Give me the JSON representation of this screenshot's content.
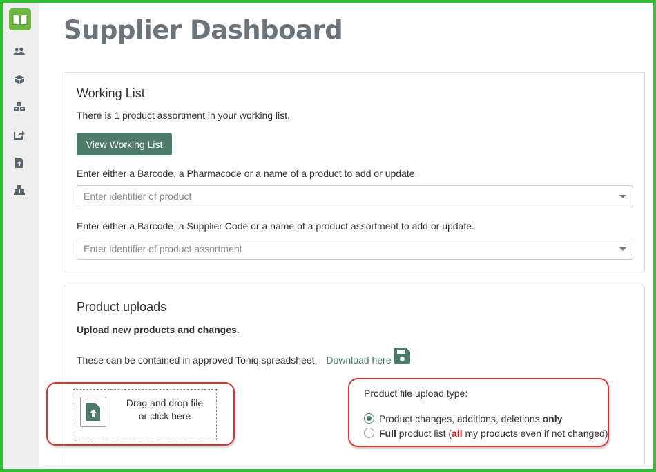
{
  "header": {
    "title": "Supplier Dashboard"
  },
  "sidebar": {
    "items": [
      {
        "icon": "users-icon"
      },
      {
        "icon": "box-icon"
      },
      {
        "icon": "boxes-icon"
      },
      {
        "icon": "share-icon"
      },
      {
        "icon": "file-upload-icon"
      },
      {
        "icon": "pallet-icon"
      }
    ]
  },
  "working_list": {
    "heading": "Working List",
    "status": "There is 1 product assortment in your working list.",
    "view_button": "View Working List",
    "product_prompt": "Enter either a Barcode, a Pharmacode or a name of a product to add or update.",
    "product_placeholder": "Enter identifier of product",
    "assortment_prompt": "Enter either a Barcode, a Supplier Code or a name of a product assortment to add or update.",
    "assortment_placeholder": "Enter identifier of product assortment"
  },
  "uploads": {
    "heading": "Product uploads",
    "subheading": "Upload new products and changes.",
    "spreadsheet_text": "These can be contained in approved Toniq spreadsheet.",
    "download_link": "Download here",
    "dropzone_line1": "Drag and drop file",
    "dropzone_line2": "or click here",
    "upload_type_label": "Product file upload type:",
    "option1": {
      "text": "Product changes, additions, deletions ",
      "emphasis": "only",
      "checked": true
    },
    "option2": {
      "emphasis": "Full",
      "text_a": " product list (",
      "highlight": "all",
      "text_b": " my products even if not changed)",
      "checked": false
    }
  },
  "colors": {
    "accent": "#4e7a6a",
    "logo": "#6fb83f",
    "frame": "#2fc02f",
    "highlight_oval": "#d33636"
  }
}
